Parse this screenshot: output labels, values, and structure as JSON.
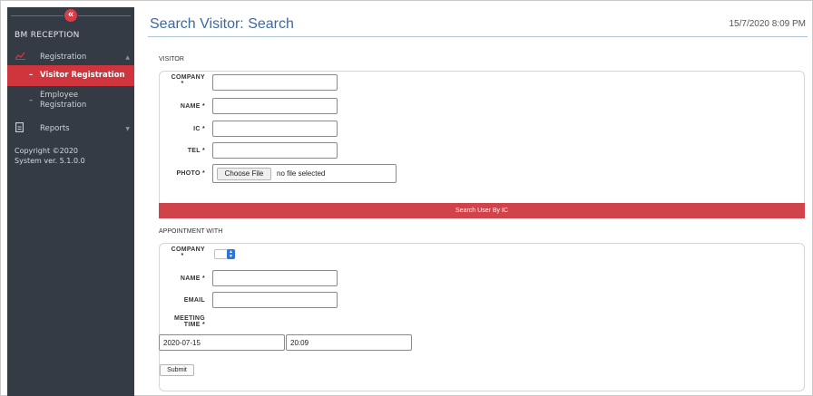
{
  "sidebar": {
    "collapse_icon": "«",
    "brand": "BM RECEPTION",
    "items": [
      {
        "label": "Registration",
        "icon": "chart-icon"
      },
      {
        "label": "Visitor Registration"
      },
      {
        "label_line1": "Employee",
        "label_line2": "Registration"
      },
      {
        "label": "Reports",
        "icon": "document-icon"
      }
    ],
    "copyright_line1": "Copyright ©2020",
    "copyright_line2": "System ver. 5.1.0.0",
    "accent_color": "#d0343c"
  },
  "header": {
    "title": "Search Visitor: Search",
    "timestamp": "15/7/2020 8:09 PM"
  },
  "visitor": {
    "section_title": "VISITOR",
    "company_label_line1": "COMPANY",
    "company_label_line2": "*",
    "name_label": "NAME *",
    "ic_label": "IC *",
    "tel_label": "TEL *",
    "photo_label": "PHOTO *",
    "file_button": "Choose File",
    "file_status": "no file selected",
    "search_button": "Search User By IC"
  },
  "appointment": {
    "section_title": "APPOINTMENT WITH",
    "company_label_line1": "COMPANY",
    "company_label_line2": "*",
    "name_label": "NAME *",
    "email_label": "EMAIL",
    "meeting_label_line1": "MEETING",
    "meeting_label_line2": "TIME *",
    "date_value": "2020-07-15",
    "time_value": "20:09",
    "submit_button": "Submit"
  }
}
